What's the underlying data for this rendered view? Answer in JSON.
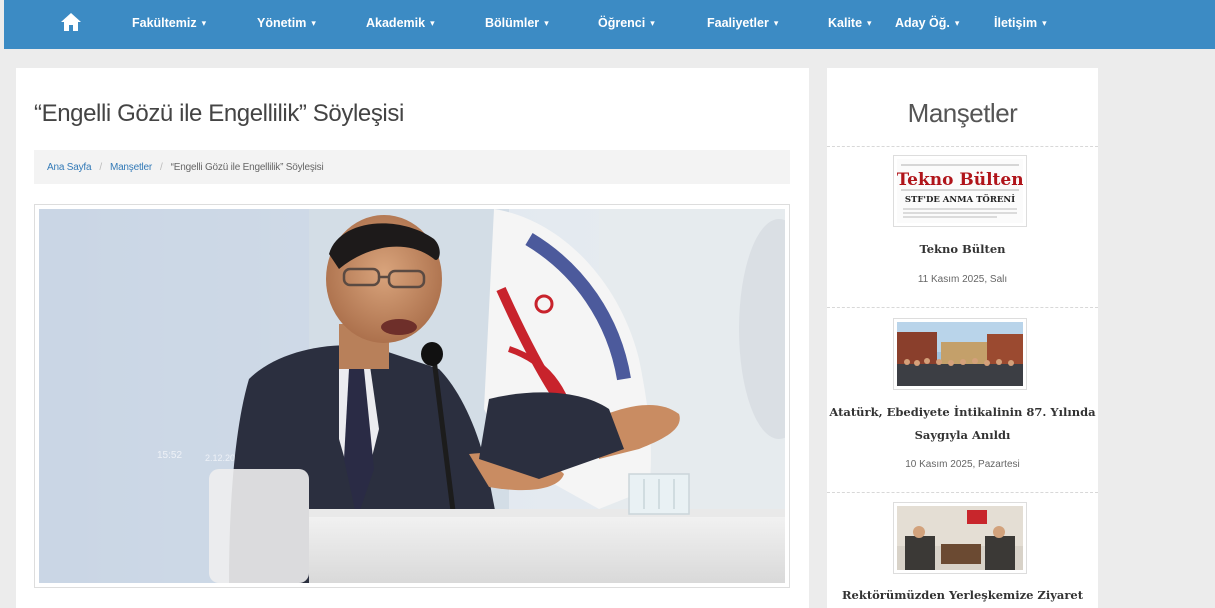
{
  "nav": {
    "home_icon": "home-icon",
    "items": [
      {
        "label": "Fakültemiz"
      },
      {
        "label": "Yönetim"
      },
      {
        "label": "Akademik"
      },
      {
        "label": "Bölümler"
      },
      {
        "label": "Öğrenci"
      },
      {
        "label": "Faaliyetler"
      },
      {
        "label": "Kalite"
      },
      {
        "label": "Aday Öğ."
      },
      {
        "label": "İletişim"
      }
    ],
    "caret": "▾"
  },
  "article": {
    "title": "“Engelli Gözü ile Engellilik” Söyleşisi",
    "breadcrumb": {
      "home": "Ana Sayfa",
      "section": "Manşetler",
      "current": "“Engelli Gözü ile Engellilik” Söyleşisi",
      "separator": "/"
    },
    "photo_overlay_time": "15:52",
    "photo_overlay_date": "2.12.2024"
  },
  "sidebar": {
    "title": "Manşetler",
    "news": [
      {
        "title_line1": "Tekno Bülten",
        "title_line2": "",
        "date": "11 Kasım 2025, Salı",
        "thumb_masthead": "Tekno Bülten",
        "thumb_headline": "STF'DE ANMA TÖRENİ"
      },
      {
        "title_line1": "Atatürk, Ebediyete İntikalinin 87. Yılında",
        "title_line2": "Saygıyla Anıldı",
        "date": "10 Kasım 2025, Pazartesi"
      },
      {
        "title_line1": "Rektörümüzden Yerleşkemize Ziyaret",
        "title_line2": "",
        "date": ""
      }
    ]
  },
  "colors": {
    "nav_bg": "#3c8bc4",
    "link": "#337ab7",
    "page_bg": "#ececec",
    "thumb_red": "#b0141a"
  }
}
